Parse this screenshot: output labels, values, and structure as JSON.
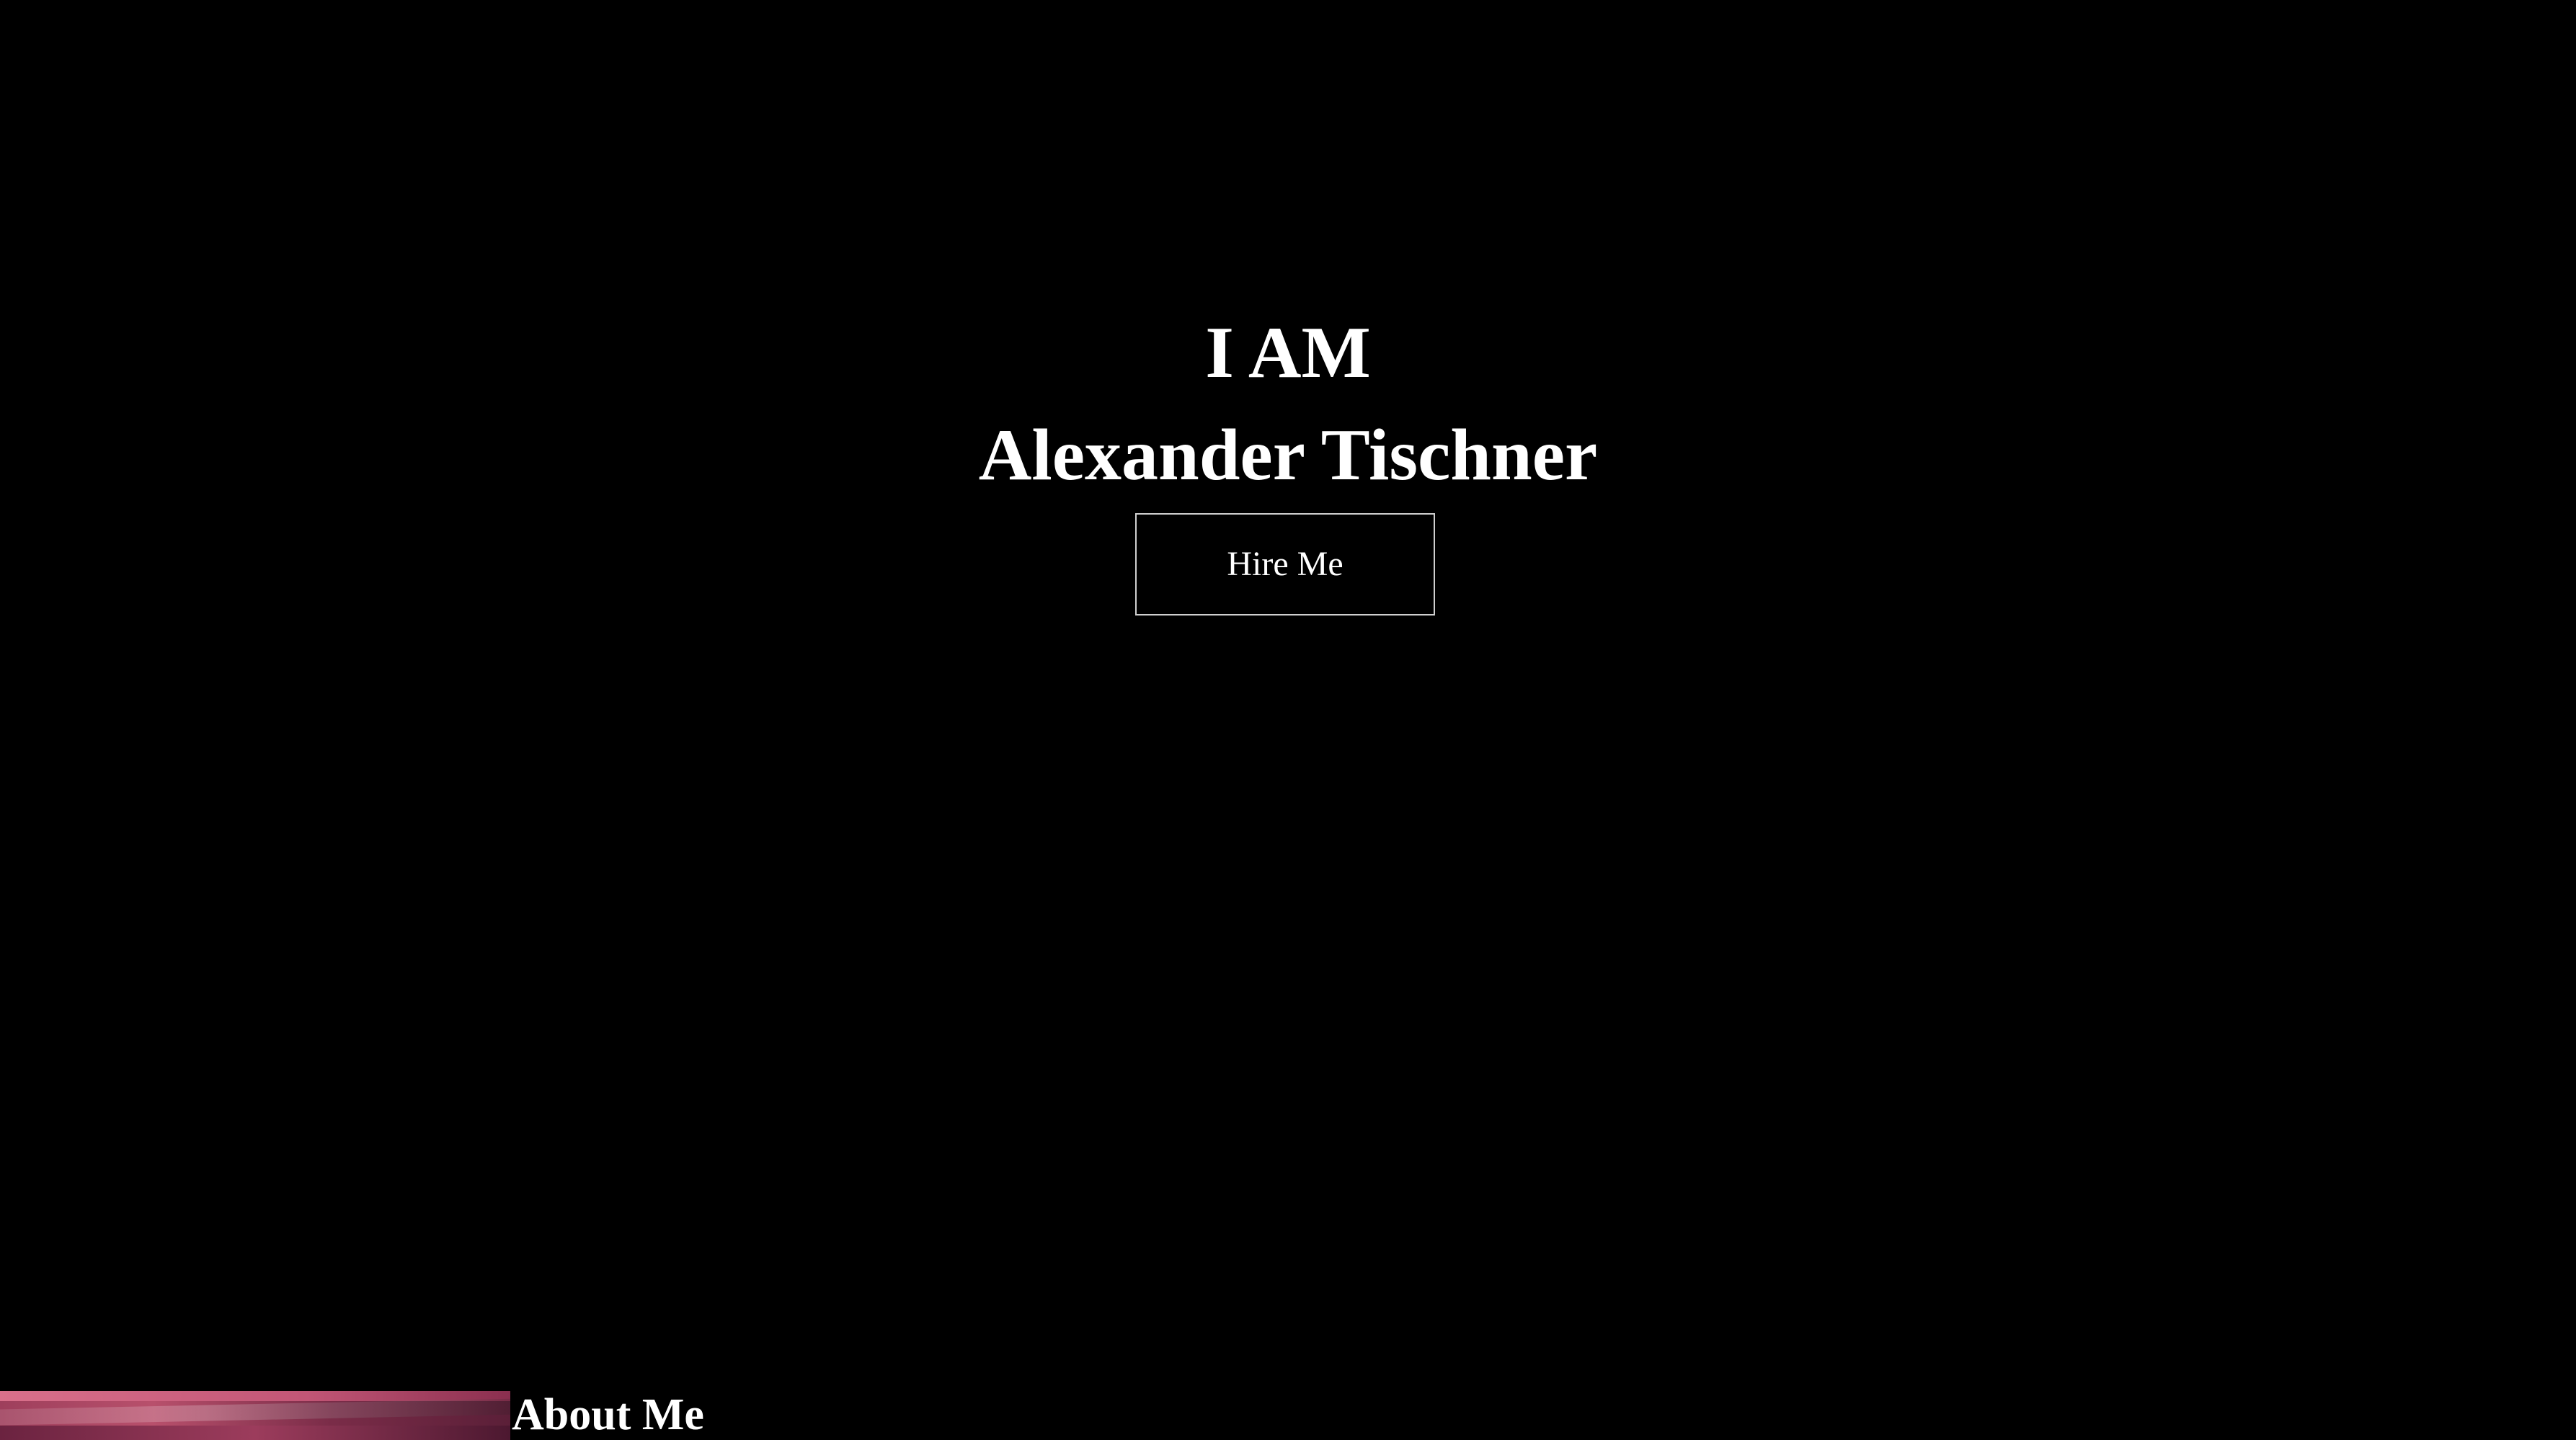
{
  "hero": {
    "line1": "I AM",
    "line2": "Alexander Tischner",
    "hire_button_label": "Hire Me"
  },
  "about": {
    "title": "About Me"
  },
  "colors": {
    "background": "#000000",
    "text": "#ffffff",
    "button_border": "#cfcfcf",
    "about_image_accent": "#b8506c"
  }
}
